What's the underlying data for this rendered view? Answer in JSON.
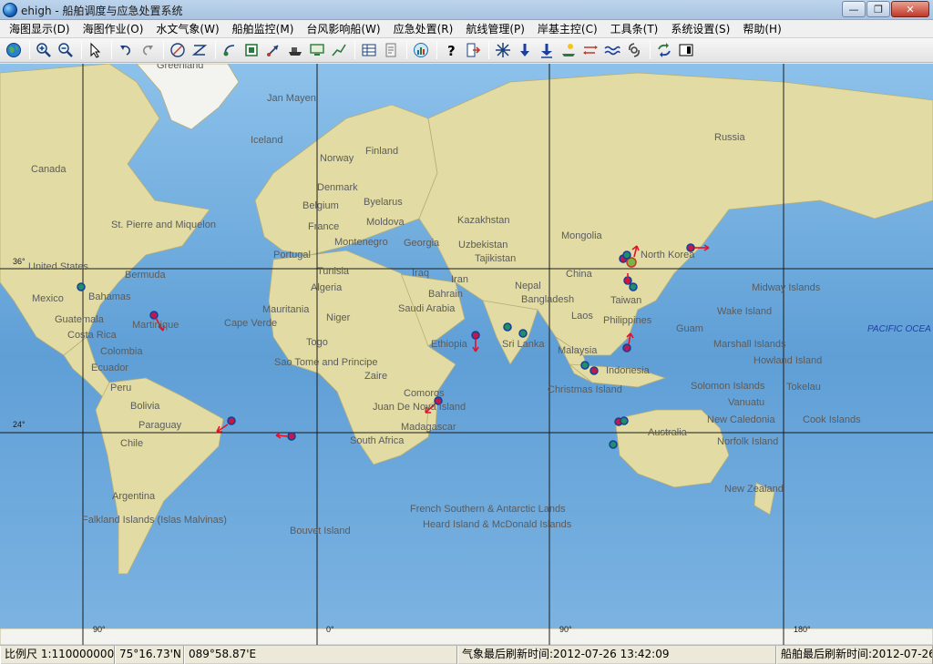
{
  "window": {
    "title": "ehigh - 船舶调度与应急处置系统",
    "icon": "globe-icon"
  },
  "menus": [
    "海图显示(D)",
    "海图作业(O)",
    "水文气象(W)",
    "船舶监控(M)",
    "台风影响船(W)",
    "应急处置(R)",
    "航线管理(P)",
    "岸基主控(C)",
    "工具条(T)",
    "系统设置(S)",
    "帮助(H)"
  ],
  "toolbar_icons": [
    "globe-icon",
    "zoom-in-icon",
    "zoom-out-icon",
    "select-arrow-icon",
    "undo-icon",
    "redo-icon",
    "measure-circle-icon",
    "zigzag-icon",
    "ship-track-icon",
    "ship-box-icon",
    "ship-arrow-icon",
    "ship-cargo-icon",
    "ship-monitor-icon",
    "route-line-icon",
    "table-icon",
    "report-icon",
    "chart-icon",
    "help-icon",
    "exit-icon",
    "snowflake-icon",
    "arrow-down-icon",
    "arrow-down-bold-icon",
    "ship-weather-icon",
    "wave-arrows-icon",
    "wave-icon",
    "typhoon-icon",
    "refresh-icon",
    "layout-icon"
  ],
  "map": {
    "labels": [
      {
        "text": "Greenland",
        "kind": "land"
      },
      {
        "text": "Jan Mayen",
        "kind": "land"
      },
      {
        "text": "Iceland",
        "kind": "land"
      },
      {
        "text": "Finland",
        "kind": "land"
      },
      {
        "text": "Norway",
        "kind": "land"
      },
      {
        "text": "Russia",
        "kind": "land"
      },
      {
        "text": "Canada",
        "kind": "land"
      },
      {
        "text": "Denmark",
        "kind": "land"
      },
      {
        "text": "Belgium",
        "kind": "land"
      },
      {
        "text": "Byelarus",
        "kind": "land"
      },
      {
        "text": "France",
        "kind": "land"
      },
      {
        "text": "Moldova",
        "kind": "land"
      },
      {
        "text": "Kazakhstan",
        "kind": "land"
      },
      {
        "text": "St. Pierre and Miquelon",
        "kind": "land"
      },
      {
        "text": "Montenegro",
        "kind": "land"
      },
      {
        "text": "Georgia",
        "kind": "land"
      },
      {
        "text": "Uzbekistan",
        "kind": "land"
      },
      {
        "text": "Mongolia",
        "kind": "land"
      },
      {
        "text": "Portugal",
        "kind": "land"
      },
      {
        "text": "Tajikistan",
        "kind": "land"
      },
      {
        "text": "North Korea",
        "kind": "land"
      },
      {
        "text": "United States",
        "kind": "land"
      },
      {
        "text": "Bermuda",
        "kind": "land"
      },
      {
        "text": "Tunisia",
        "kind": "land"
      },
      {
        "text": "Iraq",
        "kind": "land"
      },
      {
        "text": "Iran",
        "kind": "land"
      },
      {
        "text": "China",
        "kind": "land"
      },
      {
        "text": "Algeria",
        "kind": "land"
      },
      {
        "text": "Nepal",
        "kind": "land"
      },
      {
        "text": "Bahrain",
        "kind": "land"
      },
      {
        "text": "Midway Islands",
        "kind": "land"
      },
      {
        "text": "Mexico",
        "kind": "land"
      },
      {
        "text": "Bahamas",
        "kind": "land"
      },
      {
        "text": "Bangladesh",
        "kind": "land"
      },
      {
        "text": "Taiwan",
        "kind": "land"
      },
      {
        "text": "Mauritania",
        "kind": "land"
      },
      {
        "text": "Saudi Arabia",
        "kind": "land"
      },
      {
        "text": "Guatemala",
        "kind": "land"
      },
      {
        "text": "Niger",
        "kind": "land"
      },
      {
        "text": "Wake Island",
        "kind": "land"
      },
      {
        "text": "Martinique",
        "kind": "land"
      },
      {
        "text": "Cape Verde",
        "kind": "land"
      },
      {
        "text": "Laos",
        "kind": "land"
      },
      {
        "text": "Philippines",
        "kind": "land"
      },
      {
        "text": "Costa Rica",
        "kind": "land"
      },
      {
        "text": "Guam",
        "kind": "land"
      },
      {
        "text": "PACIFIC OCEA",
        "kind": "ocean"
      },
      {
        "text": "Togo",
        "kind": "land"
      },
      {
        "text": "Ethiopia",
        "kind": "land"
      },
      {
        "text": "Sri Lanka",
        "kind": "land"
      },
      {
        "text": "Marshall Islands",
        "kind": "land"
      },
      {
        "text": "Colombia",
        "kind": "land"
      },
      {
        "text": "Malaysia",
        "kind": "land"
      },
      {
        "text": "Sao Tome and Principe",
        "kind": "land"
      },
      {
        "text": "Ecuador",
        "kind": "land"
      },
      {
        "text": "Howland Island",
        "kind": "land"
      },
      {
        "text": "Indonesia",
        "kind": "land"
      },
      {
        "text": "Zaire",
        "kind": "land"
      },
      {
        "text": "Peru",
        "kind": "land"
      },
      {
        "text": "Solomon Islands",
        "kind": "land"
      },
      {
        "text": "Tokelau",
        "kind": "land"
      },
      {
        "text": "Christmas Island",
        "kind": "land"
      },
      {
        "text": "Comoros",
        "kind": "land"
      },
      {
        "text": "Vanuatu",
        "kind": "land"
      },
      {
        "text": "Bolivia",
        "kind": "land"
      },
      {
        "text": "Juan De Nova Island",
        "kind": "land"
      },
      {
        "text": "New Caledonia",
        "kind": "land"
      },
      {
        "text": "Cook Islands",
        "kind": "land"
      },
      {
        "text": "Paraguay",
        "kind": "land"
      },
      {
        "text": "Madagascar",
        "kind": "land"
      },
      {
        "text": "Australia",
        "kind": "land"
      },
      {
        "text": "Chile",
        "kind": "land"
      },
      {
        "text": "South Africa",
        "kind": "land"
      },
      {
        "text": "Norfolk Island",
        "kind": "land"
      },
      {
        "text": "New Zealand",
        "kind": "land"
      },
      {
        "text": "Argentina",
        "kind": "land"
      },
      {
        "text": "French Southern & Antarctic Lands",
        "kind": "land"
      },
      {
        "text": "Falkland Islands (Islas Malvinas)",
        "kind": "land"
      },
      {
        "text": "Heard Island & McDonald Islands",
        "kind": "land"
      },
      {
        "text": "Bouvet Island",
        "kind": "land"
      }
    ],
    "grid_labels": [
      "36°",
      "24°",
      "90°",
      "0°",
      "90°",
      "180°"
    ],
    "colors": {
      "ocean": "#6fa9da",
      "land": "#e4dfa8",
      "ship": "#c01a4a",
      "ship_alt": "#1f8f6a",
      "heading": "#e3122b"
    }
  },
  "status": {
    "scale": "比例尺 1:110000000",
    "lat": "75°16.73'N",
    "lon": "089°58.87'E",
    "weather_refresh": "气象最后刷新时间:2012-07-26 13:42:09",
    "ship_refresh": "船舶最后刷新时间:2012-07-26"
  }
}
